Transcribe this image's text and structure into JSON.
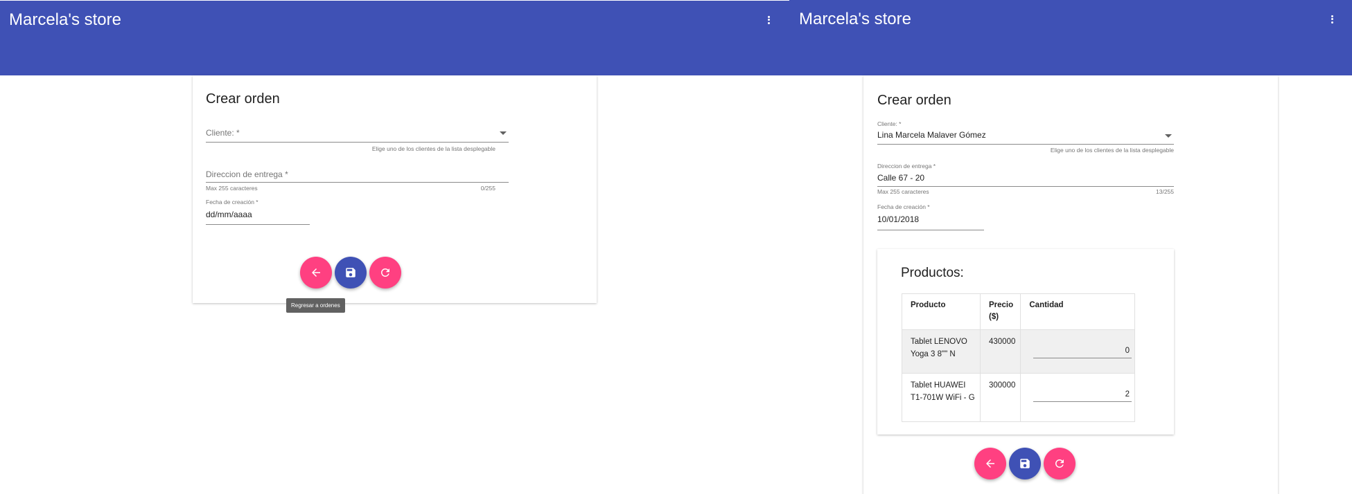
{
  "left": {
    "app_title": "Marcela's store",
    "form_title": "Crear orden",
    "cliente": {
      "label": "Cliente: *",
      "hint": "Elige uno de los clientes de la lista desplegable"
    },
    "direccion": {
      "label": "Direccion de entrega *",
      "hint": "Max 255 caracteres",
      "counter": "0/255"
    },
    "fecha": {
      "label": "Fecha de creación *",
      "value": "dd/mm/aaaa"
    },
    "tooltip": "Regresar a ordenes"
  },
  "right": {
    "app_title": "Marcela's store",
    "form_title": "Crear orden",
    "cliente": {
      "label": "Cliente: *",
      "value": "Lina Marcela Malaver Gómez",
      "hint": "Elige uno de los clientes de la lista desplegable"
    },
    "direccion": {
      "label": "Direccion de entrega *",
      "value": "Calle 67 - 20",
      "hint": "Max 255 caracteres",
      "counter": "13/255"
    },
    "fecha": {
      "label": "Fecha de creación *",
      "value": "10/01/2018"
    },
    "productos": {
      "title": "Productos:",
      "headers": {
        "producto": "Producto",
        "precio": "Precio ($)",
        "cantidad": "Cantidad"
      },
      "rows": [
        {
          "producto": "Tablet LENOVO Yoga 3 8\"\" N",
          "precio": "430000",
          "cantidad": "0"
        },
        {
          "producto": "Tablet HUAWEI T1-701W WiFi - G",
          "precio": "300000",
          "cantidad": "2"
        }
      ]
    }
  },
  "colors": {
    "primary": "#3f51b5",
    "accent": "#ff4081"
  },
  "icons": {
    "back": "arrow-left-icon",
    "save": "save-icon",
    "refresh": "refresh-icon",
    "more": "more-vert-icon"
  }
}
